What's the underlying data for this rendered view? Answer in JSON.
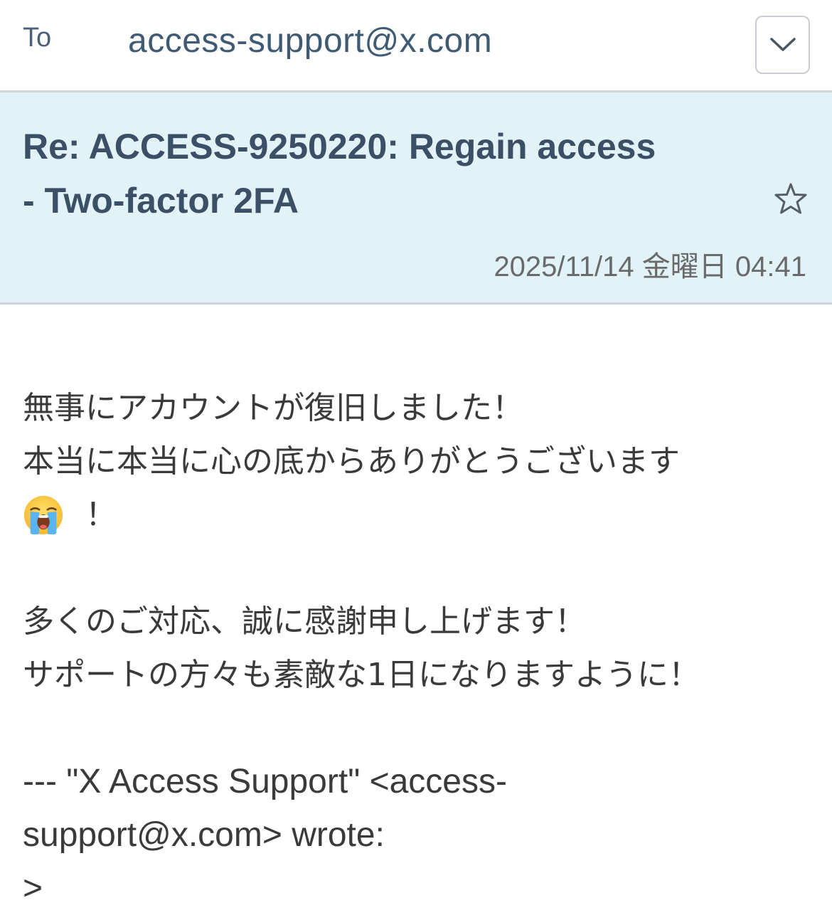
{
  "to": {
    "label": "To",
    "address": "access-support@x.com"
  },
  "header": {
    "subject_line1": "Re: ACCESS-9250220: Regain access",
    "subject_line2": "- Two-factor 2FA",
    "date": "2025/11/14 金曜日 04:41"
  },
  "body": {
    "line1": "無事にアカウントが復旧しました！",
    "line2": "本当に本当に心の底からありがとうございます",
    "line3_suffix": "！",
    "line4": "多くのご対応、誠に感謝申し上げます！",
    "line5": "サポートの方々も素敵な1日になりますように！",
    "quote_line1": "--- \"X Access Support\" <access-",
    "quote_line2": "support@x.com> wrote:",
    "quote_marker": ">"
  },
  "icons": {
    "expand": "chevron-down-icon",
    "star": "star-outline-icon",
    "emoji": "loudly-crying-face"
  },
  "colors": {
    "header_bg": "#e2f3f8",
    "subject": "#3b4f66",
    "to_text": "#3f5a73"
  }
}
